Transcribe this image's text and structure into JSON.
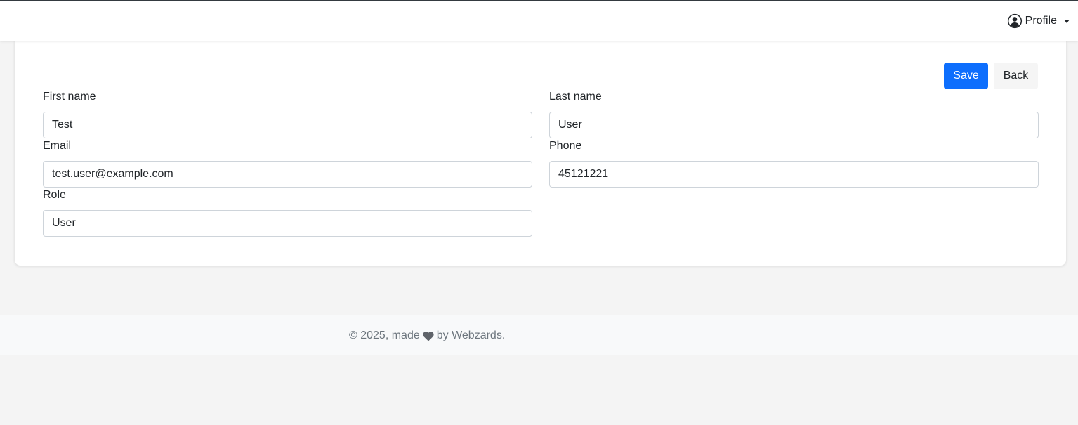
{
  "header": {
    "profile_label": "Profile",
    "icons": {
      "avatar": "person-circle-icon",
      "dropdown": "caret-down-icon"
    }
  },
  "form": {
    "actions": {
      "save_label": "Save",
      "back_label": "Back"
    },
    "fields": {
      "first_name": {
        "label": "First name",
        "value": "Test"
      },
      "last_name": {
        "label": "Last name",
        "value": "User"
      },
      "email": {
        "label": "Email",
        "value": "test.user@example.com"
      },
      "phone": {
        "label": "Phone",
        "value": "45121221"
      },
      "role": {
        "label": "Role",
        "value": "User"
      }
    }
  },
  "footer": {
    "text_before": "© 2025, made",
    "text_after": "by Webzards.",
    "icon": "heart-icon"
  },
  "colors": {
    "primary": "#0d6efd",
    "page_background": "#f4f4f4",
    "footer_background": "#f8f9fa",
    "muted_text": "#6c757d"
  }
}
